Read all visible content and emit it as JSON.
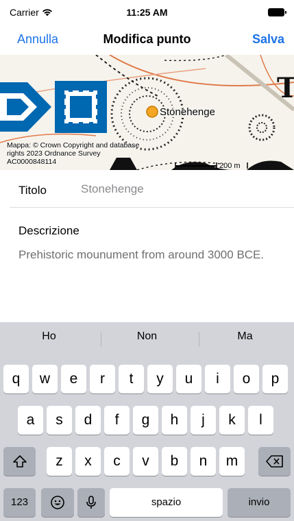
{
  "status_bar": {
    "carrier": "Carrier",
    "time": "11:25 AM"
  },
  "nav": {
    "cancel": "Annulla",
    "title": "Modifica punto",
    "save": "Salva"
  },
  "map": {
    "pin_label": "Stonehenge",
    "attribution": "Mappa: © Crown Copyright and database rights 2023 Ordnance Survey AC0000848114",
    "scale_label": "200 m",
    "pin_color": "#f5a623"
  },
  "form": {
    "title_label": "Titolo",
    "title_value": "Stonehenge",
    "description_label": "Descrizione",
    "description_value": "Prehistoric mounument from around 3000 BCE."
  },
  "keyboard": {
    "suggestions": [
      "Ho",
      "Non",
      "Ma"
    ],
    "row1": [
      "q",
      "w",
      "e",
      "r",
      "t",
      "y",
      "u",
      "i",
      "o",
      "p"
    ],
    "row2": [
      "a",
      "s",
      "d",
      "f",
      "g",
      "h",
      "j",
      "k",
      "l"
    ],
    "row3": [
      "z",
      "x",
      "c",
      "v",
      "b",
      "n",
      "m"
    ],
    "numbers_key": "123",
    "space_key": "spazio",
    "return_key": "invio",
    "shift_icon": "shift-icon",
    "delete_icon": "delete-icon",
    "emoji_icon": "emoji-icon",
    "mic_icon": "microphone-icon"
  },
  "colors": {
    "accent": "#1a73e8",
    "keyboard_bg": "#d2d4da"
  }
}
